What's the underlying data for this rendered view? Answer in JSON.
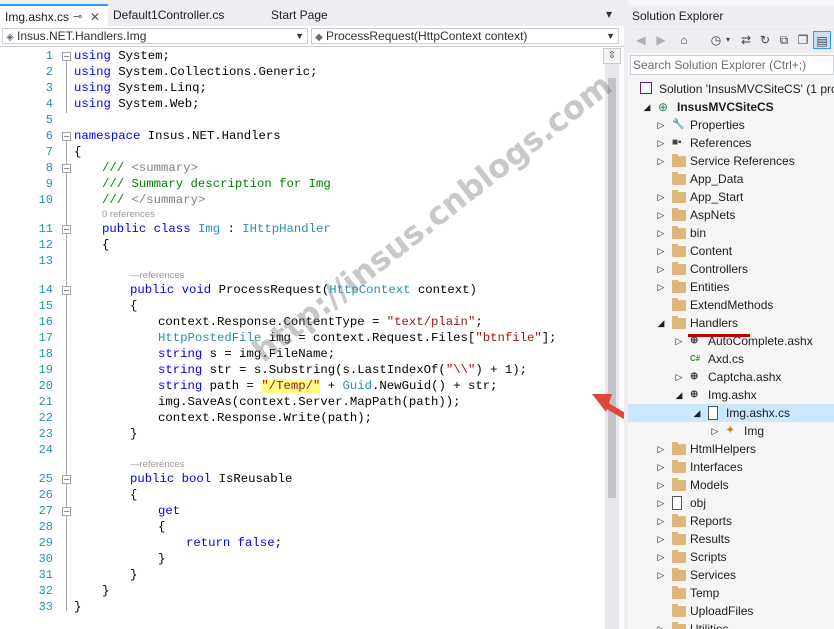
{
  "tabs": [
    {
      "label": "Img.ashx.cs",
      "active": true
    },
    {
      "label": "Default1Controller.cs",
      "active": false
    },
    {
      "label": "Start Page",
      "active": false
    }
  ],
  "nav": {
    "left": "Insus.NET.Handlers.Img",
    "right": "ProcessRequest(HttpContext context)"
  },
  "editor": {
    "line_numbers": [
      "1",
      "2",
      "3",
      "4",
      "5",
      "6",
      "7",
      "8",
      "9",
      "10",
      "11",
      "12",
      "13",
      "14",
      "15",
      "16",
      "17",
      "18",
      "19",
      "20",
      "21",
      "22",
      "23",
      "24",
      "25",
      "26",
      "27",
      "28",
      "29",
      "30",
      "31",
      "32",
      "33"
    ],
    "references_labels": [
      "0 references",
      "—references",
      "—references"
    ],
    "lines": {
      "l1": [
        "using",
        " System;"
      ],
      "l2": [
        "using",
        " System.Collections.Generic;"
      ],
      "l3": [
        "using",
        " System.Linq;"
      ],
      "l4": [
        "using",
        " System.Web;"
      ],
      "l6": [
        "namespace",
        " Insus.NET.Handlers"
      ],
      "l7": "{",
      "l8": [
        "/// ",
        "<summary>"
      ],
      "l9": "/// Summary description for Img",
      "l10": [
        "/// ",
        "</summary>"
      ],
      "l11": [
        "public",
        " ",
        "class",
        " ",
        "Img",
        " : ",
        "IHttpHandler"
      ],
      "l12": "{",
      "l14": [
        "public",
        " ",
        "void",
        " ProcessRequest(",
        "HttpContext",
        " context)"
      ],
      "l15": "{",
      "l16": [
        "context.Response.ContentType = ",
        "\"text/plain\"",
        ";"
      ],
      "l17": [
        "HttpPostedFile",
        " img = context.Request.Files[",
        "\"btnfile\"",
        "];"
      ],
      "l18": [
        "string",
        " s = img.FileName;"
      ],
      "l19": [
        "string",
        " str = s.Substring(s.LastIndexOf(",
        "\"\\\\\"",
        ") + 1);"
      ],
      "l20": [
        "string",
        " path = ",
        "\"/Temp/\"",
        " + ",
        "Guid",
        ".NewGuid() + str;"
      ],
      "l21": "img.SaveAs(context.Server.MapPath(path));",
      "l22": "context.Response.Write(path);",
      "l23": "}",
      "l25": [
        "public",
        " ",
        "bool",
        " IsReusable"
      ],
      "l26": "{",
      "l27": "get",
      "l28": "{",
      "l29": [
        "return",
        " ",
        "false",
        ";"
      ],
      "l30": "}",
      "l31": "}",
      "l32": "}",
      "l33": "}"
    }
  },
  "watermark": "http://insus.cnblogs.com",
  "solution_explorer": {
    "title": "Solution Explorer",
    "search_placeholder": "Search Solution Explorer (Ctrl+;)",
    "solution": "Solution 'InsusMVCSiteCS' (1 pro",
    "project": "InsusMVCSiteCS",
    "items": [
      "Properties",
      "References",
      "Service References",
      "App_Data",
      "App_Start",
      "AspNets",
      "bin",
      "Content",
      "Controllers",
      "Entities",
      "ExtendMethods",
      "Handlers",
      "AutoComplete.ashx",
      "Axd.cs",
      "Captcha.ashx",
      "Img.ashx",
      "Img.ashx.cs",
      "Img",
      "HtmlHelpers",
      "Interfaces",
      "Models",
      "obj",
      "Reports",
      "Results",
      "Scripts",
      "Services",
      "Temp",
      "UploadFiles",
      "Utilities"
    ]
  },
  "colors": {
    "keyword": "#0000ff",
    "type": "#2b91af",
    "string": "#a31515",
    "comment": "#008000",
    "highlight": "#fffd85",
    "arrow": "#e0463a",
    "selection": "#cce8ff"
  }
}
